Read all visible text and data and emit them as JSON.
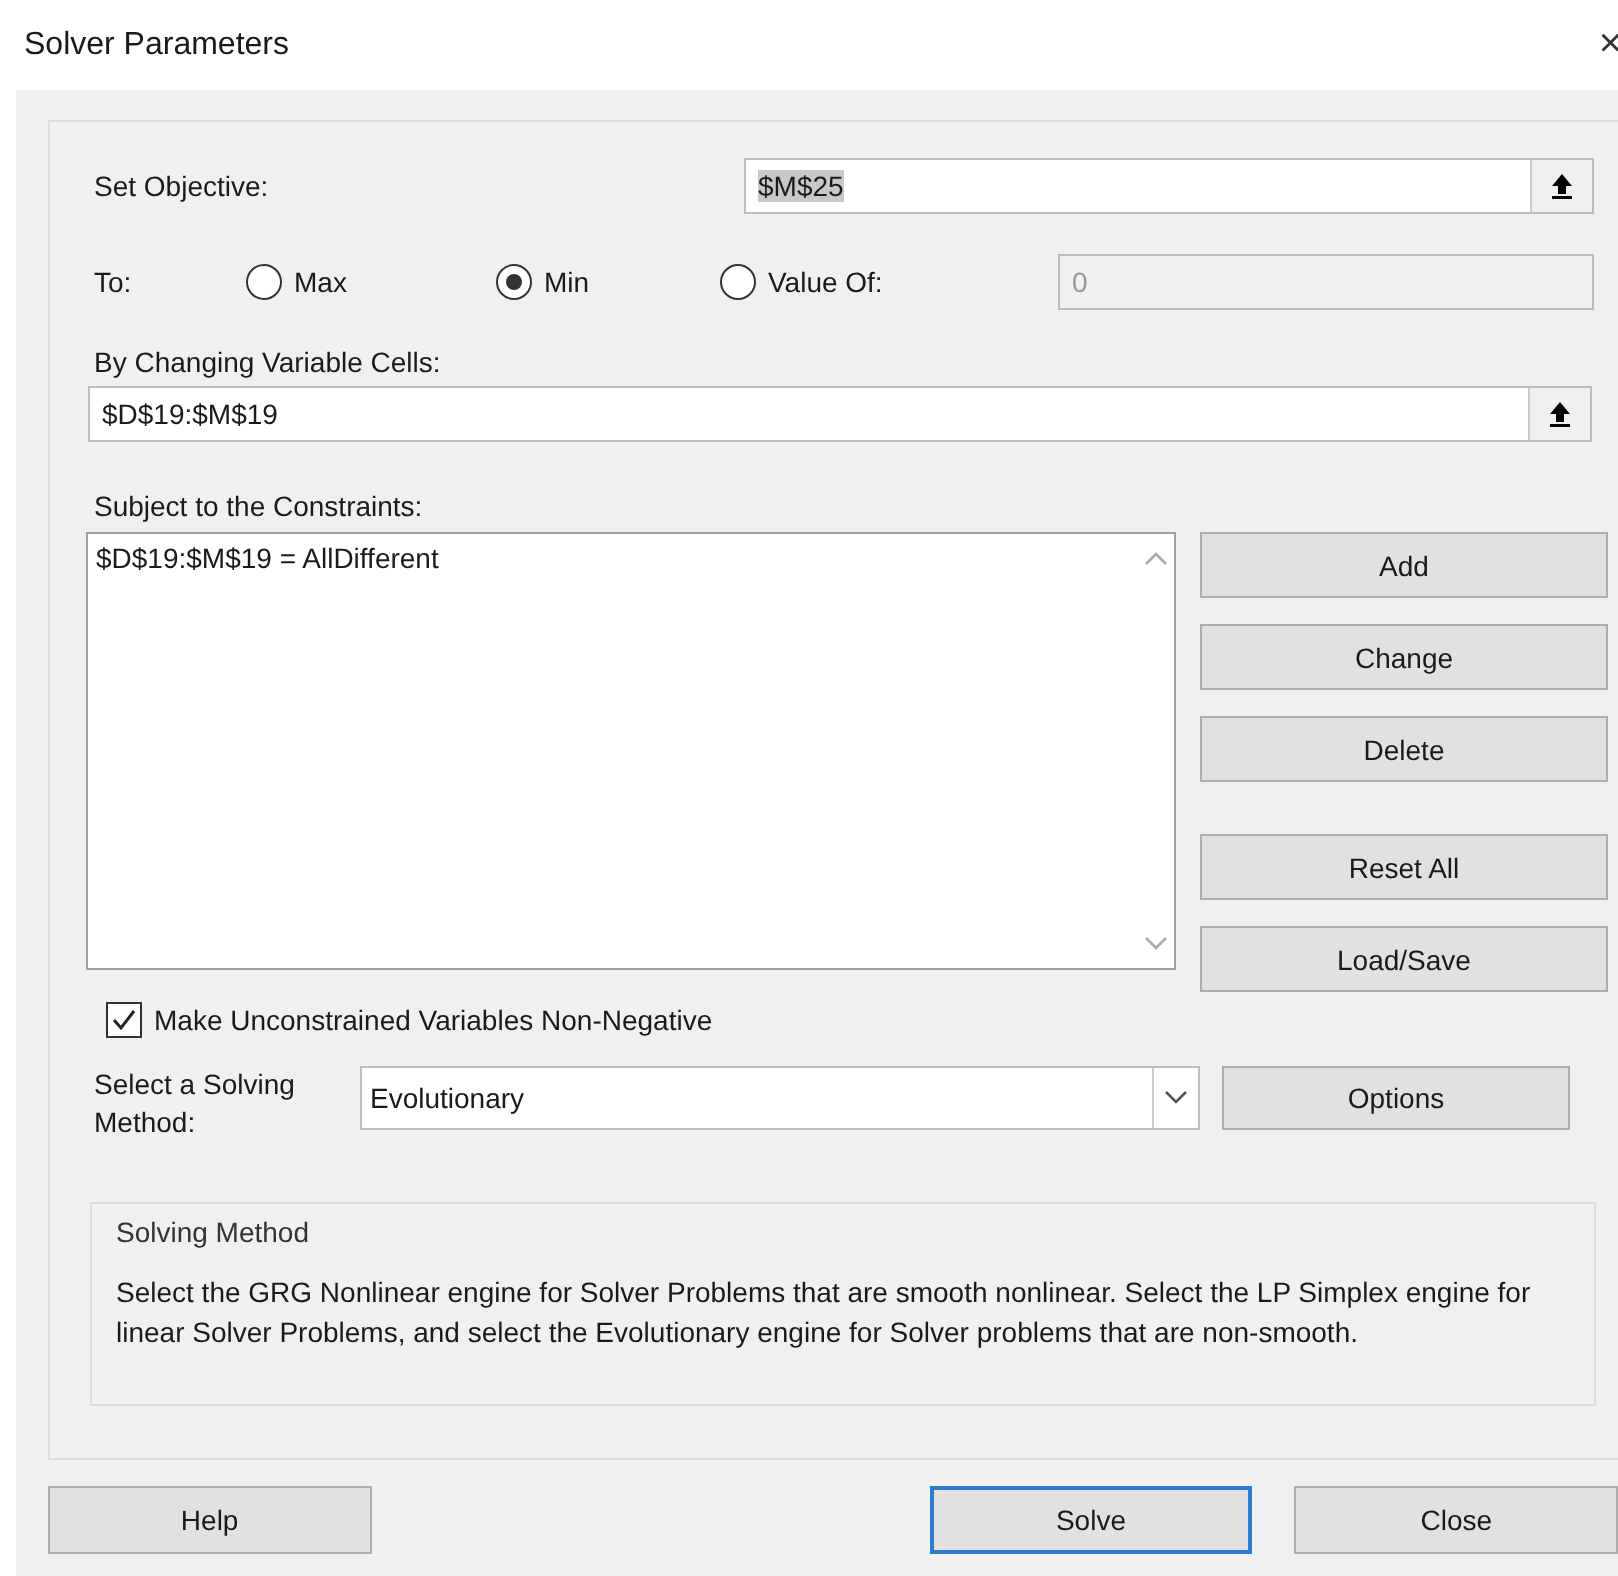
{
  "window": {
    "title": "Solver Parameters",
    "close": "×"
  },
  "objective": {
    "label": "Set Objective:",
    "value": "$M$25",
    "text_selected": true
  },
  "to": {
    "label": "To:",
    "options": [
      {
        "label": "Max",
        "selected": false
      },
      {
        "label": "Min",
        "selected": true
      },
      {
        "label": "Value Of:",
        "selected": false
      }
    ],
    "value_field": {
      "value": "0",
      "disabled": true
    }
  },
  "variable_cells": {
    "label": "By Changing Variable Cells:",
    "value": "$D$19:$M$19"
  },
  "constraints": {
    "label": "Subject to the Constraints:",
    "items": [
      "$D$19:$M$19 = AllDifferent"
    ]
  },
  "constraint_buttons": [
    "Add",
    "Change",
    "Delete",
    "Reset All",
    "Load/Save"
  ],
  "non_negative": {
    "label": "Make Unconstrained Variables Non-Negative",
    "checked": true
  },
  "solving_method": {
    "label": "Select a Solving Method:",
    "value": "Evolutionary",
    "options_button": "Options"
  },
  "description": {
    "title": "Solving Method",
    "text": "Select the GRG Nonlinear engine for Solver Problems that are smooth nonlinear. Select the LP Simplex engine for linear Solver Problems, and select the Evolutionary engine for Solver problems that are non-smooth."
  },
  "footer_buttons": [
    {
      "label": "Help",
      "default": false
    },
    {
      "label": "Solve",
      "default": true
    },
    {
      "label": "Close",
      "default": false
    }
  ]
}
